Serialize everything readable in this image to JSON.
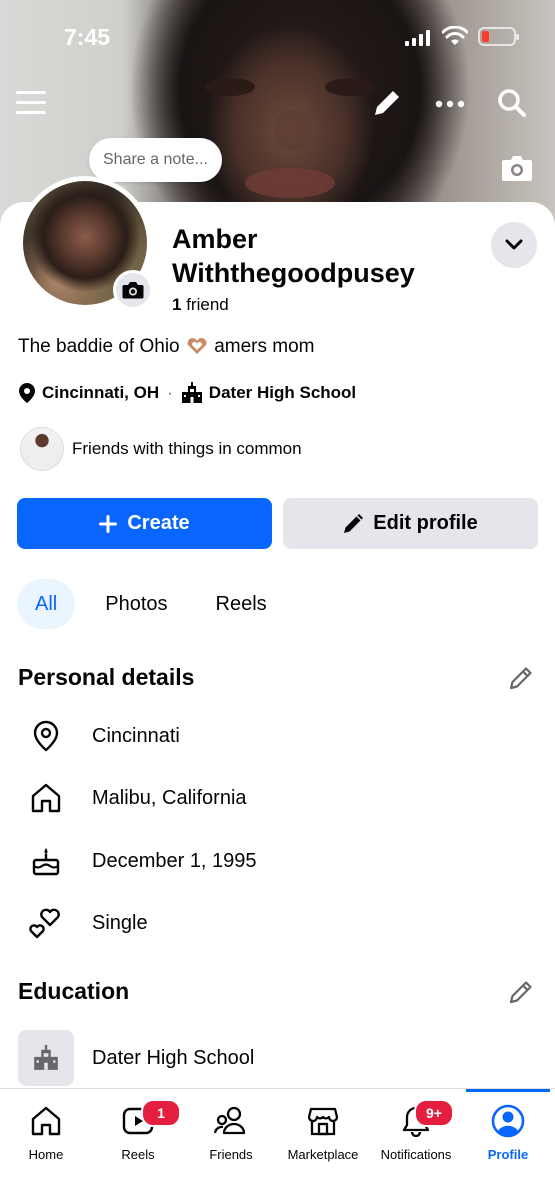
{
  "status": {
    "time": "7:45"
  },
  "note": {
    "placeholder": "Share a note..."
  },
  "profile": {
    "name": "Amber Withthegoodpusey",
    "friend_count": "1",
    "friend_label": "friend",
    "bio_start": "The baddie of Ohio",
    "bio_end": "amers mom",
    "location": "Cincinnati, OH",
    "separator": "·",
    "school": "Dater High School",
    "mutual_text": "Friends with things in common"
  },
  "actions": {
    "create_label": "Create",
    "edit_label": "Edit profile"
  },
  "tabs": [
    {
      "label": "All",
      "active": true
    },
    {
      "label": "Photos",
      "active": false
    },
    {
      "label": "Reels",
      "active": false
    }
  ],
  "personal": {
    "title": "Personal details",
    "items": [
      {
        "icon": "location-pin-icon",
        "text": "Cincinnati"
      },
      {
        "icon": "home-icon",
        "text": "Malibu, California"
      },
      {
        "icon": "birthday-cake-icon",
        "text": "December 1, 1995"
      },
      {
        "icon": "hearts-icon",
        "text": "Single"
      }
    ]
  },
  "education": {
    "title": "Education",
    "items": [
      {
        "icon": "school-building-icon",
        "text": "Dater High School"
      }
    ]
  },
  "nav": [
    {
      "label": "Home"
    },
    {
      "label": "Reels",
      "badge": "1"
    },
    {
      "label": "Friends"
    },
    {
      "label": "Marketplace"
    },
    {
      "label": "Notifications",
      "badge": "9+"
    },
    {
      "label": "Profile",
      "active": true
    }
  ],
  "colors": {
    "accent": "#0866ff",
    "badge": "#e41e3f",
    "button_gray": "#e4e6eb"
  }
}
